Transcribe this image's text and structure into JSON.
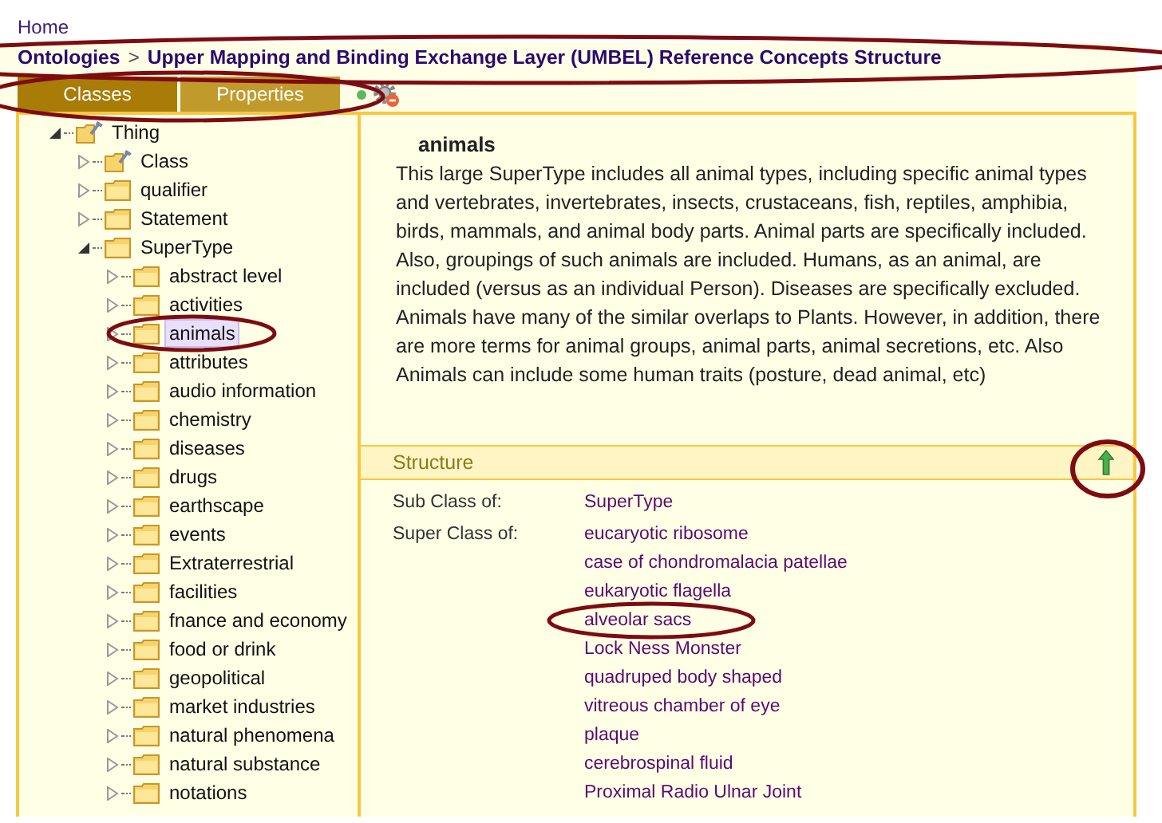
{
  "home_link": "Home",
  "breadcrumb": {
    "root": "Ontologies",
    "separator": ">",
    "current": "Upper Mapping and Binding Exchange Layer (UMBEL) Reference Concepts Structure"
  },
  "tabs": [
    {
      "label": "Classes",
      "selected": true
    },
    {
      "label": "Properties",
      "selected": false
    }
  ],
  "tree": [
    {
      "label": "Thing",
      "kind": "class",
      "expanded": true,
      "selected": false,
      "children": [
        {
          "label": "Class",
          "kind": "class",
          "expanded": false,
          "selected": false
        },
        {
          "label": "qualifier",
          "kind": "folder",
          "expanded": false,
          "selected": false
        },
        {
          "label": "Statement",
          "kind": "folder",
          "expanded": false,
          "selected": false
        },
        {
          "label": "SuperType",
          "kind": "folder",
          "expanded": true,
          "selected": false,
          "children": [
            {
              "label": "abstract level",
              "kind": "folder",
              "expanded": false,
              "selected": false
            },
            {
              "label": "activities",
              "kind": "folder",
              "expanded": false,
              "selected": false
            },
            {
              "label": "animals",
              "kind": "folder",
              "expanded": false,
              "selected": true
            },
            {
              "label": "attributes",
              "kind": "folder",
              "expanded": false,
              "selected": false
            },
            {
              "label": "audio information",
              "kind": "folder",
              "expanded": false,
              "selected": false
            },
            {
              "label": "chemistry",
              "kind": "folder",
              "expanded": false,
              "selected": false
            },
            {
              "label": "diseases",
              "kind": "folder",
              "expanded": false,
              "selected": false
            },
            {
              "label": "drugs",
              "kind": "folder",
              "expanded": false,
              "selected": false
            },
            {
              "label": "earthscape",
              "kind": "folder",
              "expanded": false,
              "selected": false
            },
            {
              "label": "events",
              "kind": "folder",
              "expanded": false,
              "selected": false
            },
            {
              "label": "Extraterrestrial",
              "kind": "folder",
              "expanded": false,
              "selected": false
            },
            {
              "label": "facilities",
              "kind": "folder",
              "expanded": false,
              "selected": false
            },
            {
              "label": "fnance and economy",
              "kind": "folder",
              "expanded": false,
              "selected": false
            },
            {
              "label": "food or drink",
              "kind": "folder",
              "expanded": false,
              "selected": false
            },
            {
              "label": "geopolitical",
              "kind": "folder",
              "expanded": false,
              "selected": false
            },
            {
              "label": "market industries",
              "kind": "folder",
              "expanded": false,
              "selected": false
            },
            {
              "label": "natural phenomena",
              "kind": "folder",
              "expanded": false,
              "selected": false
            },
            {
              "label": "natural substance",
              "kind": "folder",
              "expanded": false,
              "selected": false
            },
            {
              "label": "notations",
              "kind": "folder",
              "expanded": false,
              "selected": false
            }
          ]
        }
      ]
    }
  ],
  "detail": {
    "title": "animals",
    "description": "This large SuperType includes all animal types, including specific animal types and vertebrates, invertebrates, insects, crustaceans, fish, reptiles, amphibia, birds, mammals, and animal body parts. Animal parts are specifically included. Also, groupings of such animals are included. Humans, as an animal, are included (versus as an individual Person). Diseases are specifically excluded. Animals have many of the similar overlaps to Plants. However, in addition, there are more terms for animal groups, animal parts, animal secretions, etc. Also Animals can include some human traits (posture, dead animal, etc)"
  },
  "structure": {
    "heading": "Structure",
    "rows": [
      {
        "label": "Sub Class of:",
        "values": [
          "SuperType"
        ]
      },
      {
        "label": "Super Class of:",
        "values": [
          "eucaryotic ribosome",
          "case of chondromalacia patellae",
          "eukaryotic flagella",
          "alveolar sacs",
          "Lock Ness Monster",
          "quadruped body shaped",
          "vitreous chamber of eye",
          "plaque",
          "cerebrospinal fluid",
          "Proximal Radio Ulnar Joint"
        ]
      }
    ]
  }
}
